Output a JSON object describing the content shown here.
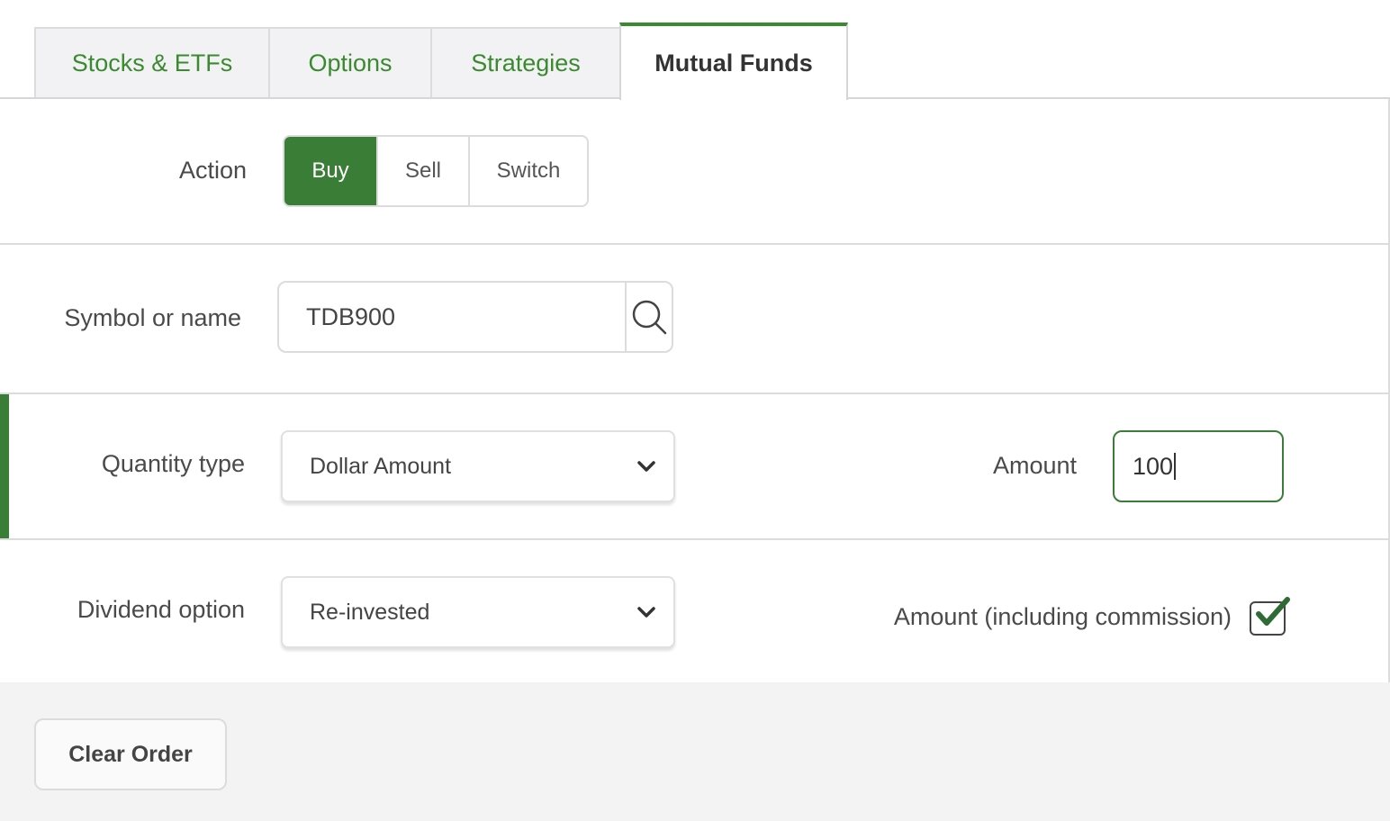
{
  "tabs": [
    {
      "label": "Stocks & ETFs"
    },
    {
      "label": "Options"
    },
    {
      "label": "Strategies"
    },
    {
      "label": "Mutual Funds",
      "active": true
    }
  ],
  "form": {
    "action": {
      "label": "Action",
      "options": [
        "Buy",
        "Sell",
        "Switch"
      ],
      "selected": "Buy"
    },
    "symbol": {
      "label": "Symbol or name",
      "value": "TDB900",
      "search_icon": "search-icon"
    },
    "quantity_type": {
      "label": "Quantity type",
      "value": "Dollar Amount"
    },
    "amount": {
      "label": "Amount",
      "value": "100"
    },
    "dividend_option": {
      "label": "Dividend option",
      "value": "Re-invested"
    },
    "amount_including_commission": {
      "label": "Amount (including commission)",
      "checked": true
    }
  },
  "footer": {
    "clear_label": "Clear Order"
  },
  "colors": {
    "accent": "#3a7d37",
    "tab_text": "#3a8a2f"
  }
}
